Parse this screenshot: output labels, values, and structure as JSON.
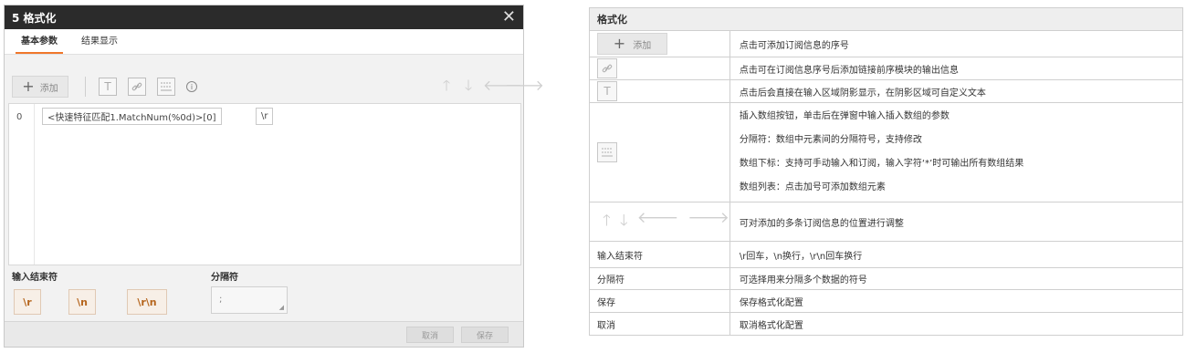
{
  "dialog": {
    "title": "5 格式化",
    "tabs": [
      {
        "label": "基本参数",
        "active": true
      },
      {
        "label": "结果显示",
        "active": false
      }
    ],
    "toolbar": {
      "add_label": "添加",
      "icons": [
        "text-icon",
        "link-icon",
        "array-icon",
        "info-icon"
      ],
      "arrows": [
        "arrow-up-icon",
        "arrow-down-icon",
        "arrow-left-icon",
        "arrow-right-icon"
      ]
    },
    "editor": {
      "line_number": "0",
      "tokens": [
        "<快速特征匹配1.MatchNum(%0d)>[0]",
        "\\r"
      ]
    },
    "end_char_label": "输入结束符",
    "end_char_options": [
      "\\r",
      "\\n",
      "\\r\\n"
    ],
    "separator_label": "分隔符",
    "separator_value": ";",
    "cancel_label": "取消",
    "save_label": "保存",
    "accent_color": "#f0772b"
  },
  "reference": {
    "header": "格式化",
    "rows": {
      "add": {
        "label": "添加",
        "desc": "点击可添加订阅信息的序号"
      },
      "link": {
        "desc": "点击可在订阅信息序号后添加链接前序模块的输出信息"
      },
      "text": {
        "desc": "点击后会直接在输入区域阴影显示，在阴影区域可自定义文本"
      },
      "array": {
        "desc": [
          "插入数组按钮，单击后在弹窗中输入插入数组的参数",
          "分隔符：数组中元素间的分隔符号，支持修改",
          "数组下标：支持可手动输入和订阅，输入字符‘*’时可输出所有数组结果",
          "数组列表：点击加号可添加数组元素"
        ]
      },
      "arrows": {
        "desc": "可对添加的多条订阅信息的位置进行调整"
      },
      "end_char": {
        "label": "输入结束符",
        "desc": "\\r回车，\\n换行，\\r\\n回车换行"
      },
      "separator": {
        "label": "分隔符",
        "desc": "可选择用来分隔多个数据的符号"
      },
      "save": {
        "label": "保存",
        "desc": "保存格式化配置"
      },
      "cancel": {
        "label": "取消",
        "desc": "取消格式化配置"
      }
    }
  }
}
